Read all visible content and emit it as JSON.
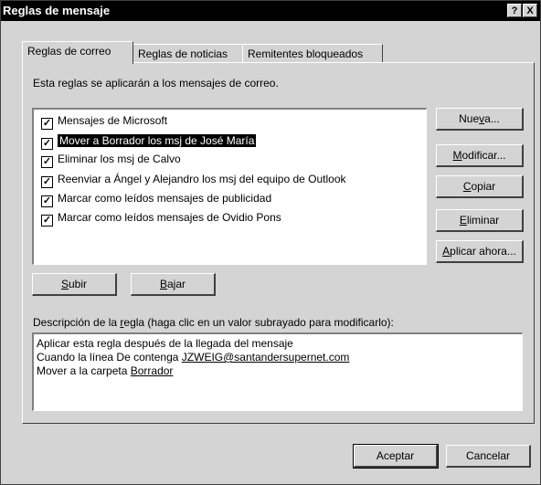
{
  "window": {
    "title": "Reglas de mensaje",
    "help_label": "?",
    "close_label": "X"
  },
  "tabs": [
    {
      "label": "Reglas de correo",
      "active": true
    },
    {
      "label": "Reglas de noticias",
      "active": false
    },
    {
      "label": "Remitentes bloqueados",
      "active": false
    }
  ],
  "intro": "Esta reglas se aplicarán a los mensajes de correo.",
  "rules": [
    {
      "label": "Mensajes de Microsoft",
      "checked": true,
      "selected": false
    },
    {
      "label": "Mover a Borrador los msj de José María",
      "checked": true,
      "selected": true
    },
    {
      "label": "Eliminar los msj de Calvo",
      "checked": true,
      "selected": false
    },
    {
      "label": "Reenviar a Ángel y Alejandro los msj del equipo de Outlook",
      "checked": true,
      "selected": false
    },
    {
      "label": "Marcar como leídos mensajes de publicidad",
      "checked": true,
      "selected": false
    },
    {
      "label": "Marcar como leídos mensajes de Ovidio Pons",
      "checked": true,
      "selected": false
    }
  ],
  "side_buttons": {
    "nueva": {
      "pre": "Nue",
      "u": "v",
      "post": "a..."
    },
    "modificar": {
      "pre": "",
      "u": "M",
      "post": "odificar..."
    },
    "copiar": {
      "pre": "",
      "u": "C",
      "post": "opiar"
    },
    "eliminar": {
      "pre": "",
      "u": "E",
      "post": "liminar"
    },
    "aplicar": {
      "pre": "",
      "u": "A",
      "post": "plicar ahora..."
    }
  },
  "move_buttons": {
    "subir": {
      "pre": "",
      "u": "S",
      "post": "ubir"
    },
    "bajar": {
      "pre": "",
      "u": "B",
      "post": "ajar"
    }
  },
  "description": {
    "label_pre": "Descripción de la ",
    "label_u": "r",
    "label_post": "egla (haga clic en un valor subrayado para modificarlo):",
    "line1": "Aplicar esta regla después de la llegada del mensaje",
    "line2_text": "Cuando la línea De contenga ",
    "line2_link": "JZWEIG@santandersupernet.com",
    "line3_text": "Mover a la carpeta ",
    "line3_link": "Borrador"
  },
  "footer": {
    "accept_label": "Aceptar",
    "cancel_label": "Cancelar"
  },
  "colors": {
    "face": "#d4d4d4",
    "titlebar": "#000000",
    "selection": "#000000"
  }
}
